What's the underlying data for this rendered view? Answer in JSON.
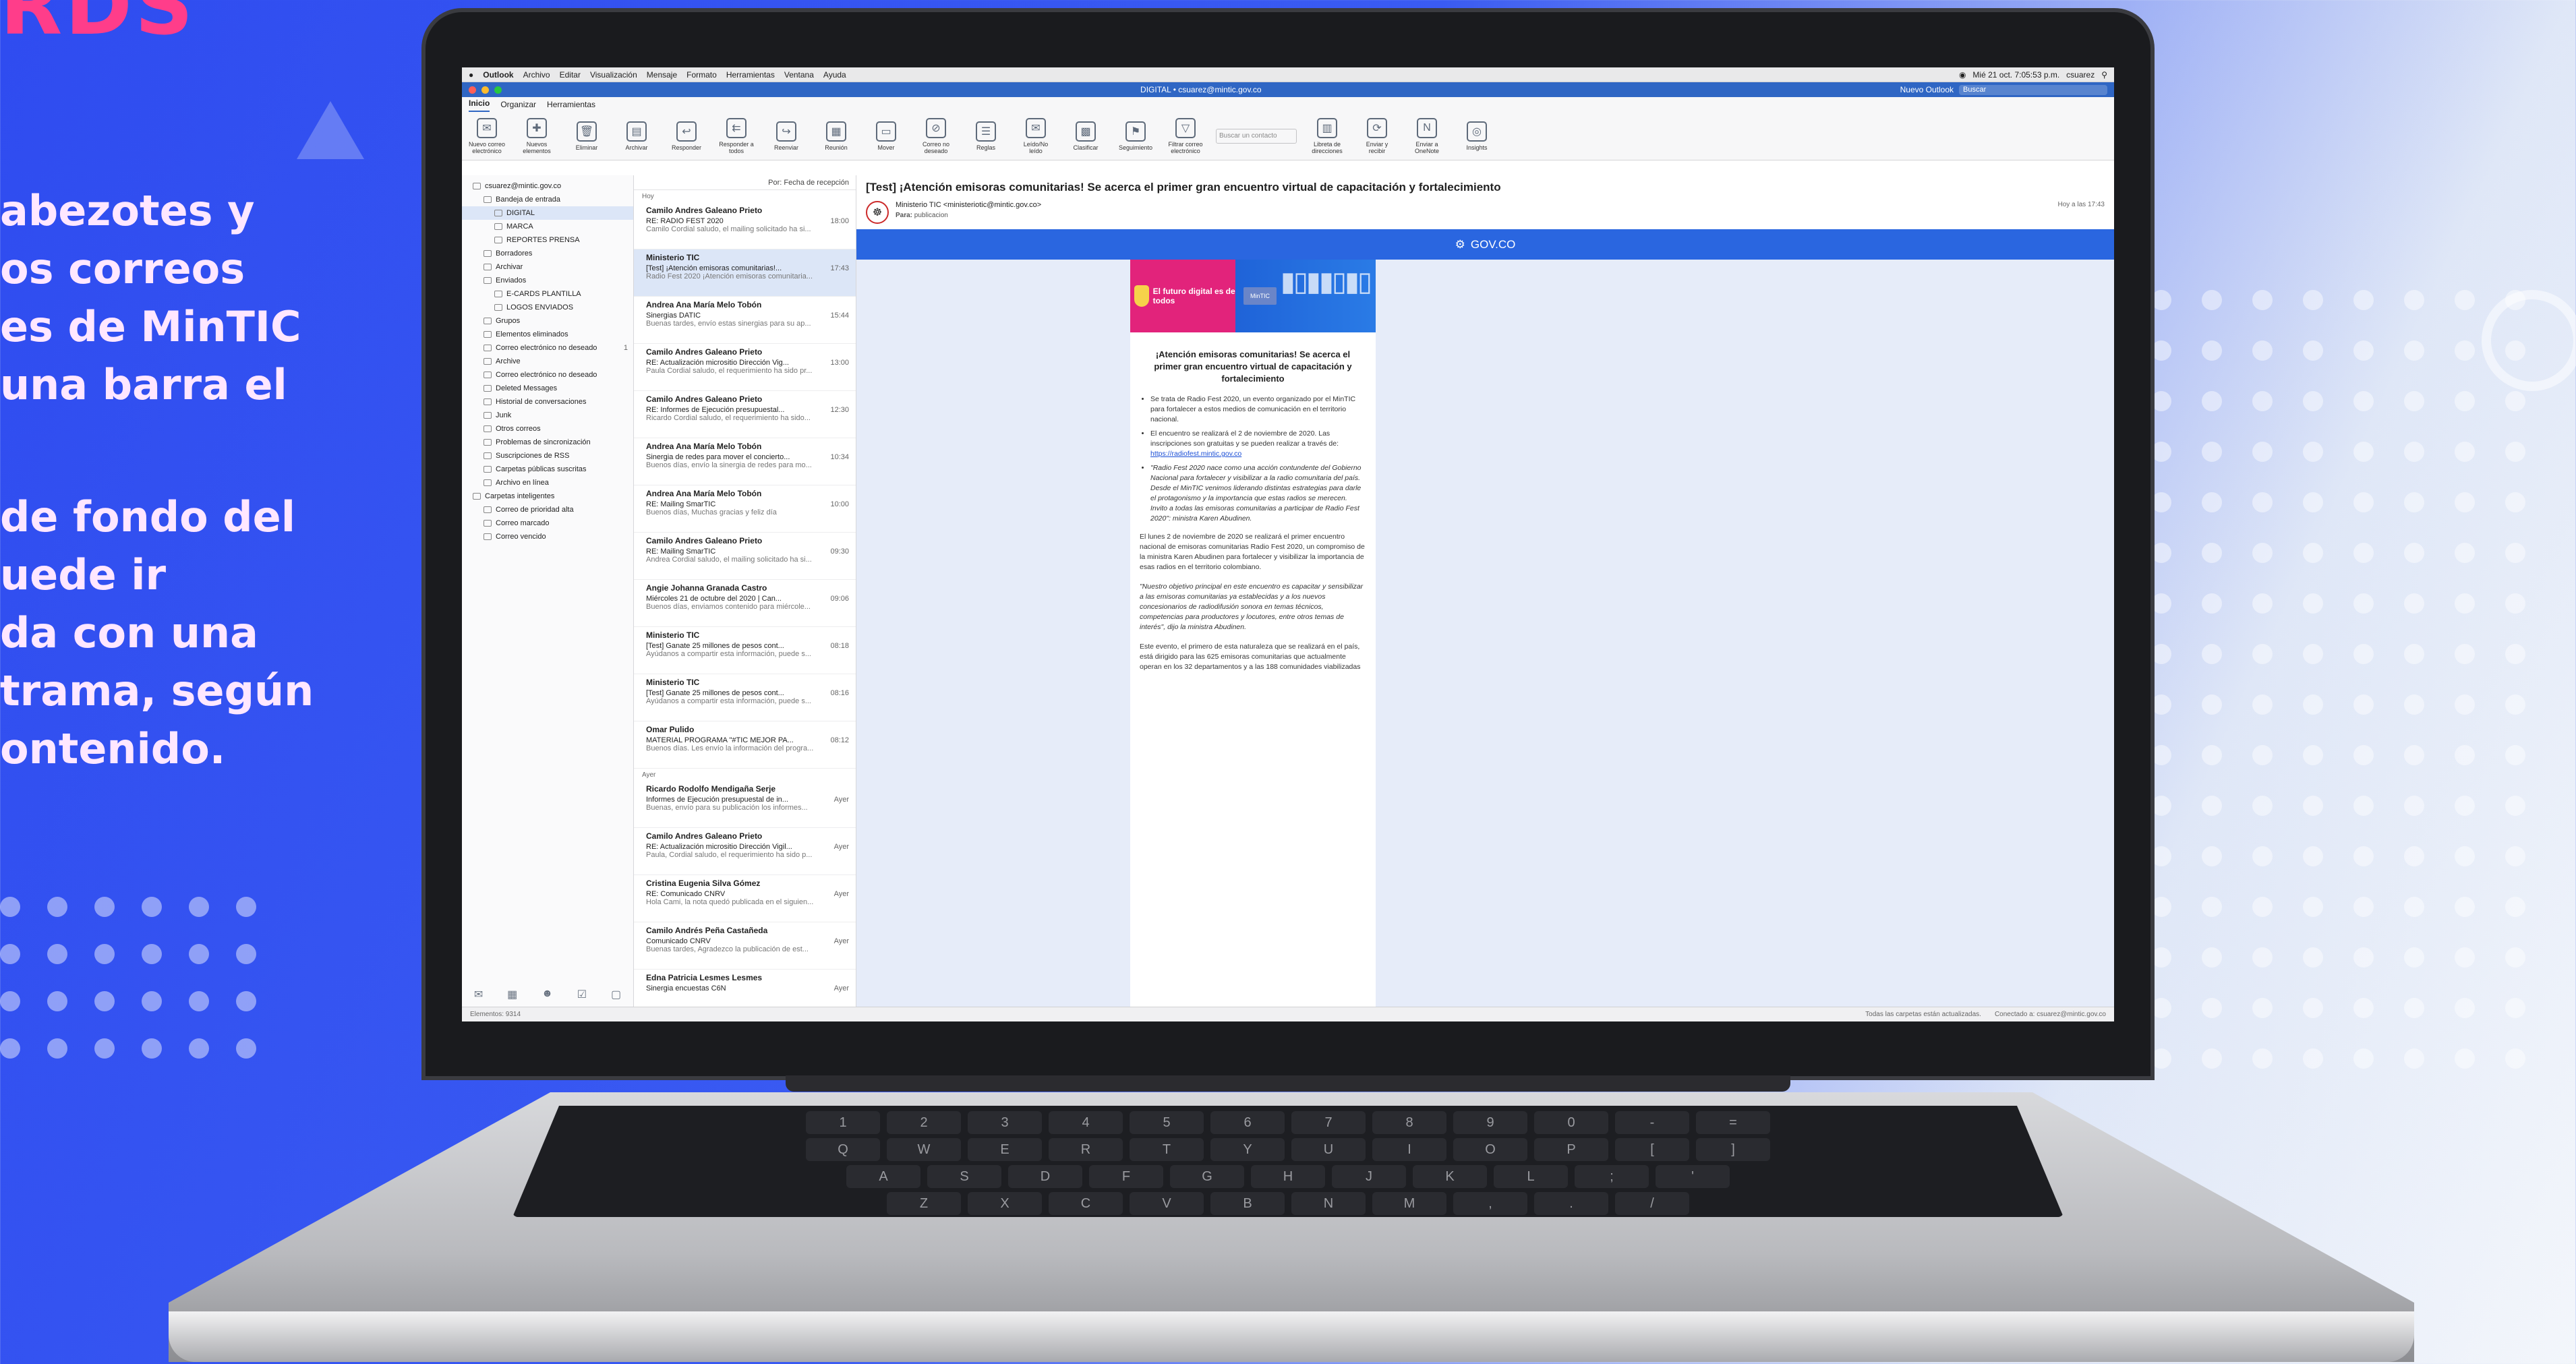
{
  "poster": {
    "header_fragment": "RDS",
    "copy_lines_1": [
      "abezotes y",
      "os correos",
      "es de MinTIC",
      "una barra el"
    ],
    "copy_lines_2": [
      "de fondo del",
      "uede ir",
      "da con una",
      "trama, según",
      "ontenido."
    ]
  },
  "mac_menubar": {
    "app": "Outlook",
    "items": [
      "Archivo",
      "Editar",
      "Visualización",
      "Mensaje",
      "Formato",
      "Herramientas",
      "Ventana",
      "Ayuda"
    ],
    "clock": "Mié 21 oct. 7:05:53 p.m.",
    "user": "csuarez"
  },
  "window": {
    "title": "DIGITAL • csuarez@mintic.gov.co",
    "toggle_label": "Nuevo Outlook",
    "search_placeholder": "Buscar"
  },
  "ribbon": {
    "tabs": [
      "Inicio",
      "Organizar",
      "Herramientas"
    ],
    "buttons": [
      {
        "label": "Nuevo correo electrónico",
        "icon": "new-mail-icon"
      },
      {
        "label": "Nuevos elementos",
        "icon": "new-items-icon"
      },
      {
        "label": "Eliminar",
        "icon": "delete-icon"
      },
      {
        "label": "Archivar",
        "icon": "archive-icon"
      },
      {
        "label": "Responder",
        "icon": "reply-icon"
      },
      {
        "label": "Responder a todos",
        "icon": "reply-all-icon"
      },
      {
        "label": "Reenviar",
        "icon": "forward-icon"
      },
      {
        "label": "Reunión",
        "icon": "meeting-icon"
      },
      {
        "label": "Mover",
        "icon": "move-icon"
      },
      {
        "label": "Correo no deseado",
        "icon": "junk-icon"
      },
      {
        "label": "Reglas",
        "icon": "rules-icon"
      },
      {
        "label": "Leído/No leído",
        "icon": "read-icon"
      },
      {
        "label": "Clasificar",
        "icon": "categorize-icon"
      },
      {
        "label": "Seguimiento",
        "icon": "flag-icon"
      },
      {
        "label": "Filtrar correo electrónico",
        "icon": "filter-icon"
      },
      {
        "label": "Libreta de direcciones",
        "icon": "address-book-icon"
      },
      {
        "label": "Enviar y recibir",
        "icon": "send-receive-icon"
      },
      {
        "label": "Enviar a OneNote",
        "icon": "onenote-icon"
      },
      {
        "label": "Insights",
        "icon": "insights-icon"
      }
    ],
    "search_contact_placeholder": "Buscar un contacto"
  },
  "folders": [
    {
      "label": "csuarez@mintic.gov.co",
      "level": 1
    },
    {
      "label": "Bandeja de entrada",
      "level": 2
    },
    {
      "label": "DIGITAL",
      "level": 3,
      "selected": true
    },
    {
      "label": "MARCA",
      "level": 3
    },
    {
      "label": "REPORTES PRENSA",
      "level": 3
    },
    {
      "label": "Borradores",
      "level": 2
    },
    {
      "label": "Archivar",
      "level": 2
    },
    {
      "label": "Enviados",
      "level": 2
    },
    {
      "label": "E-CARDS PLANTILLA",
      "level": 3
    },
    {
      "label": "LOGOS ENVIADOS",
      "level": 3
    },
    {
      "label": "Grupos",
      "level": 2
    },
    {
      "label": "Elementos eliminados",
      "level": 2
    },
    {
      "label": "Correo electrónico no deseado",
      "level": 2,
      "count": "1"
    },
    {
      "label": "Archive",
      "level": 2
    },
    {
      "label": "Correo electrónico no deseado",
      "level": 2
    },
    {
      "label": "Deleted Messages",
      "level": 2
    },
    {
      "label": "Historial de conversaciones",
      "level": 2
    },
    {
      "label": "Junk",
      "level": 2
    },
    {
      "label": "Otros correos",
      "level": 2
    },
    {
      "label": "Problemas de sincronización",
      "level": 2
    },
    {
      "label": "Suscripciones de RSS",
      "level": 2
    },
    {
      "label": "Carpetas públicas suscritas",
      "level": 2
    },
    {
      "label": "Archivo en línea",
      "level": 2
    },
    {
      "label": "Carpetas inteligentes",
      "level": 1
    },
    {
      "label": "Correo de prioridad alta",
      "level": 2
    },
    {
      "label": "Correo marcado",
      "level": 2
    },
    {
      "label": "Correo vencido",
      "level": 2
    }
  ],
  "message_list": {
    "sort_label": "Por: Fecha de recepción",
    "group_today": "Hoy",
    "group_yesterday": "Ayer",
    "messages_today": [
      {
        "from": "Camilo Andres Galeano Prieto",
        "subject": "RE: RADIO FEST 2020",
        "time": "18:00",
        "preview": "Camilo Cordial saludo, el mailing solicitado ha si..."
      },
      {
        "from": "Ministerio TIC",
        "subject": "[Test] ¡Atención emisoras comunitarias!...",
        "time": "17:43",
        "preview": "Radio Fest 2020 ¡Atención emisoras comunitaria...",
        "selected": true
      },
      {
        "from": "Andrea Ana María Melo Tobón",
        "subject": "Sinergias DATIC",
        "time": "15:44",
        "preview": "Buenas tardes, envío estas sinergias para su ap..."
      },
      {
        "from": "Camilo Andres Galeano Prieto",
        "subject": "RE: Actualización micrositio Dirección Vig...",
        "time": "13:00",
        "preview": "Paula Cordial saludo, el requerimiento ha sido pr..."
      },
      {
        "from": "Camilo Andres Galeano Prieto",
        "subject": "RE: Informes de Ejecución presupuestal...",
        "time": "12:30",
        "preview": "Ricardo Cordial saludo, el requerimiento ha sido..."
      },
      {
        "from": "Andrea Ana María Melo Tobón",
        "subject": "Sinergia de redes para mover el concierto...",
        "time": "10:34",
        "preview": "Buenos días, envío la sinergia de redes para mo..."
      },
      {
        "from": "Andrea Ana María Melo Tobón",
        "subject": "RE: Mailing SmarTIC",
        "time": "10:00",
        "preview": "Buenos días, Muchas gracias y feliz día"
      },
      {
        "from": "Camilo Andres Galeano Prieto",
        "subject": "RE: Mailing SmarTIC",
        "time": "09:30",
        "preview": "Andrea Cordial saludo, el mailing solicitado ha si..."
      },
      {
        "from": "Angie Johanna Granada Castro",
        "subject": "Miércoles 21 de octubre del 2020 | Can...",
        "time": "09:06",
        "preview": "Buenos días, enviamos contenido para miércole..."
      },
      {
        "from": "Ministerio TIC",
        "subject": "[Test] Ganate 25 millones de pesos cont...",
        "time": "08:18",
        "preview": "Ayúdanos a compartir esta información, puede s..."
      },
      {
        "from": "Ministerio TIC",
        "subject": "[Test] Ganate 25 millones de pesos cont...",
        "time": "08:16",
        "preview": "Ayúdanos a compartir esta información, puede s..."
      },
      {
        "from": "Omar Pulido",
        "subject": "MATERIAL PROGRAMA \"#TIC MEJOR PA...",
        "time": "08:12",
        "preview": "Buenos días. Les envío la información del progra..."
      }
    ],
    "messages_yesterday": [
      {
        "from": "Ricardo Rodolfo Mendigaña Serje",
        "subject": "Informes de Ejecución presupuestal de in...",
        "time": "Ayer",
        "preview": "Buenas, envío para su publicación los informes..."
      },
      {
        "from": "Camilo Andres Galeano Prieto",
        "subject": "RE: Actualización micrositio Dirección Vigil...",
        "time": "Ayer",
        "preview": "Paula, Cordial saludo, el requerimiento ha sido p..."
      },
      {
        "from": "Cristina Eugenia Silva Gómez",
        "subject": "RE: Comunicado CNRV",
        "time": "Ayer",
        "preview": "Hola Cami, la nota quedó publicada en el siguien..."
      },
      {
        "from": "Camilo Andrés Peña Castañeda",
        "subject": "Comunicado CNRV",
        "time": "Ayer",
        "preview": "Buenas tardes, Agradezco la publicación de est..."
      },
      {
        "from": "Edna Patricia Lesmes Lesmes",
        "subject": "Sinergia encuestas C6N",
        "time": "Ayer",
        "preview": ""
      }
    ]
  },
  "reading_pane": {
    "subject": "[Test] ¡Atención emisoras comunitarias! Se acerca el primer gran encuentro virtual de capacitación y fortalecimiento",
    "sender": "Ministerio TIC <ministeriotic@mintic.gov.co>",
    "to_label": "Para:",
    "to": "publicacion",
    "received": "Hoy a las 17:43",
    "gov_band": "GOV.CO",
    "banner_text": "El futuro digital es de todos",
    "banner_badge": "MinTIC",
    "email_title": "¡Atención emisoras comunitarias! Se acerca el primer gran encuentro virtual de capacitación y fortalecimiento",
    "bullet_1": "Se trata de Radio Fest 2020, un evento organizado por el MinTIC para fortalecer a estos medios de comunicación en el territorio nacional.",
    "bullet_2": "El encuentro se realizará el 2 de noviembre de 2020. Las inscripciones son gratuitas y se pueden realizar a través de:",
    "bullet_2_link": "https://radiofest.mintic.gov.co",
    "bullet_3": "\"Radio Fest 2020 nace como una acción contundente del Gobierno Nacional para fortalecer y visibilizar a la radio comunitaria del país. Desde el MinTIC venimos liderando distintas estrategias para darle el protagonismo y la importancia que estas radios se merecen. Invito a todas las emisoras comunitarias a participar de Radio Fest 2020\": ministra Karen Abudinen.",
    "para_1": "El lunes 2 de noviembre de 2020 se realizará el primer encuentro nacional de emisoras comunitarias Radio Fest 2020, un compromiso de la ministra Karen Abudinen para fortalecer y visibilizar la importancia de esas radios en el territorio colombiano.",
    "para_2": "\"Nuestro objetivo principal en este encuentro es capacitar y sensibilizar a las emisoras comunitarias ya establecidas y a los nuevos concesionarios de radiodifusión sonora en temas técnicos, competencias para productores y locutores, entre otros temas de interés\", dijo la ministra Abudinen.",
    "para_3": "Este evento, el primero de esta naturaleza que se realizará en el país, está dirigido para las 625 emisoras comunitarias que actualmente operan en los 32 departamentos y a las 188 comunidades viabilizadas"
  },
  "status_bar": {
    "items_count": "Elementos: 9314",
    "sync": "Todas las carpetas están actualizadas.",
    "connection": "Conectado a: csuarez@mintic.gov.co"
  },
  "keyboard_rows": [
    [
      "1",
      "2",
      "3",
      "4",
      "5",
      "6",
      "7",
      "8",
      "9",
      "0",
      "-",
      "="
    ],
    [
      "Q",
      "W",
      "E",
      "R",
      "T",
      "Y",
      "U",
      "I",
      "O",
      "P",
      "[",
      "]"
    ],
    [
      "A",
      "S",
      "D",
      "F",
      "G",
      "H",
      "J",
      "K",
      "L",
      ";",
      "'"
    ],
    [
      "Z",
      "X",
      "C",
      "V",
      "B",
      "N",
      "M",
      ",",
      ".",
      "/"
    ]
  ],
  "colors": {
    "brand_blue": "#2f4cf0",
    "accent_pink": "#ff3d8a",
    "outlook_blue": "#2f66c4",
    "gov_blue": "#2a66e0",
    "mintic_magenta": "#e2237b"
  }
}
